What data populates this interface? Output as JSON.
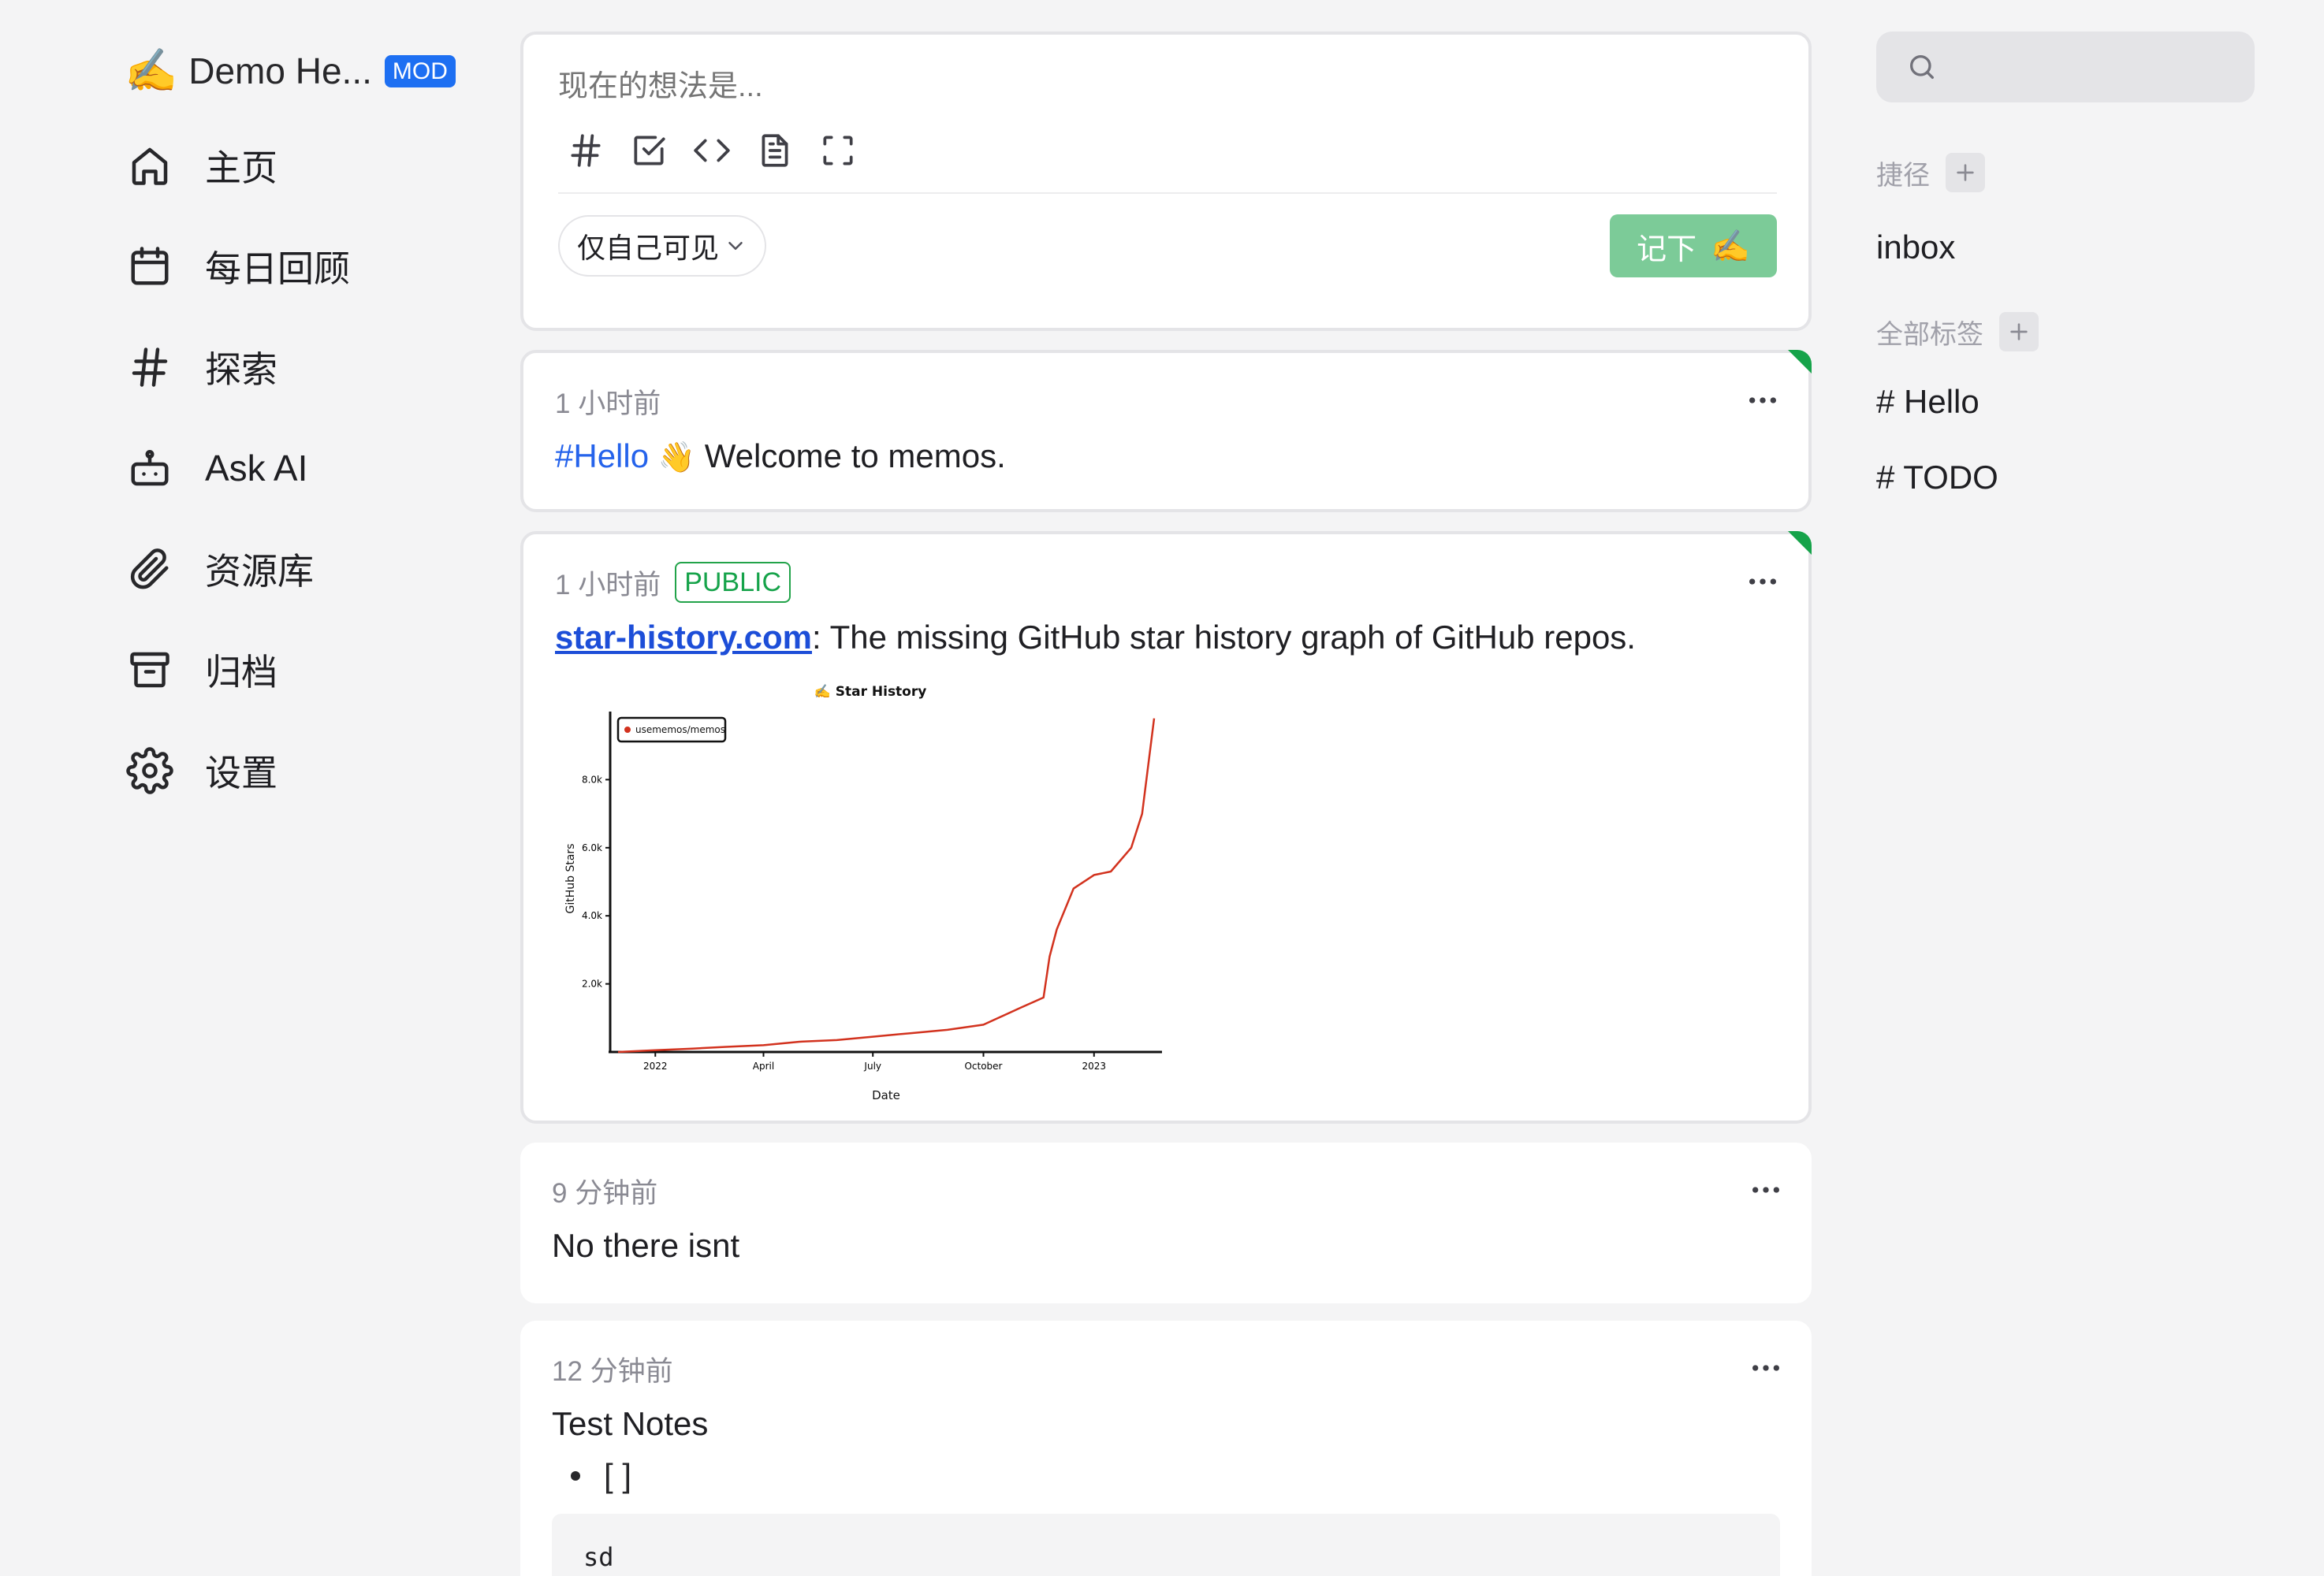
{
  "brand": {
    "emoji": "✍️",
    "name": "Demo He...",
    "badge": "MOD"
  },
  "nav": [
    {
      "label": "主页",
      "icon": "home-icon"
    },
    {
      "label": "每日回顾",
      "icon": "calendar-icon"
    },
    {
      "label": "探索",
      "icon": "hash-icon"
    },
    {
      "label": "Ask AI",
      "icon": "bot-icon"
    },
    {
      "label": "资源库",
      "icon": "paperclip-icon"
    },
    {
      "label": "归档",
      "icon": "archive-icon"
    },
    {
      "label": "设置",
      "icon": "gear-icon"
    }
  ],
  "editor": {
    "placeholder": "现在的想法是...",
    "tools": [
      "hash-icon",
      "checkbox-icon",
      "code-icon",
      "file-icon",
      "fullscreen-icon"
    ],
    "visibility": "仅自己可见",
    "submit_label": "记下",
    "submit_emoji": "✍️"
  },
  "memos": [
    {
      "time": "1 小时前",
      "pinned": true,
      "tag": "#Hello",
      "emoji": "👋",
      "text": " Welcome to memos."
    },
    {
      "time": "1 小时前",
      "pinned": true,
      "visibility": "PUBLIC",
      "link": "star-history.com",
      "text": ": The missing GitHub star history graph of GitHub repos."
    },
    {
      "time": "9 分钟前",
      "text": "No there isnt"
    },
    {
      "time": "12 分钟前",
      "text": "Test Notes",
      "list_item": "[ ]",
      "code": "sd"
    }
  ],
  "chart_data": {
    "type": "line",
    "title": "Star History",
    "title_emoji": "✍️",
    "xlabel": "Date",
    "ylabel": "GitHub Stars",
    "x_ticks": [
      "2022",
      "April",
      "July",
      "October",
      "2023"
    ],
    "y_ticks": [
      "2.0k",
      "4.0k",
      "6.0k",
      "8.0k"
    ],
    "ylim": [
      0,
      10000
    ],
    "legend_position": "top-left",
    "series": [
      {
        "name": "usememos/memos",
        "color": "#d2321e",
        "x": [
          "2021-12",
          "2022-01",
          "2022-02",
          "2022-03",
          "2022-04",
          "2022-05",
          "2022-06",
          "2022-07",
          "2022-08",
          "2022-09",
          "2022-10",
          "2022-11",
          "2022-11-20",
          "2022-11-25",
          "2022-12",
          "2022-12-15",
          "2023-01",
          "2023-01-15",
          "2023-02",
          "2023-02-10",
          "2023-02-20"
        ],
        "values": [
          0,
          50,
          100,
          150,
          200,
          300,
          350,
          450,
          550,
          650,
          800,
          1300,
          1600,
          2800,
          3600,
          4800,
          5200,
          5300,
          6000,
          7000,
          9800
        ]
      }
    ]
  },
  "right": {
    "search_placeholder": "",
    "shortcuts_title": "捷径",
    "shortcuts": [
      "inbox"
    ],
    "tags_title": "全部标签",
    "tags": [
      "# Hello",
      "# TODO"
    ]
  }
}
